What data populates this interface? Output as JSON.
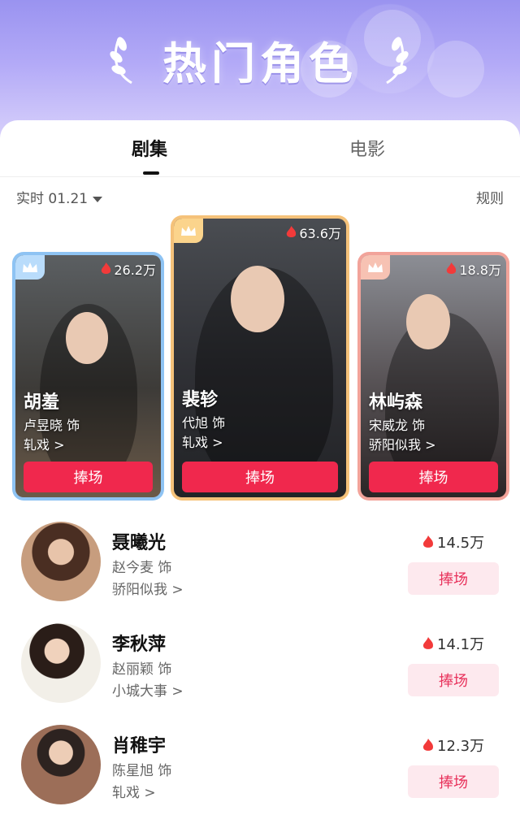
{
  "header": {
    "title": "热门角色"
  },
  "tabs": [
    {
      "label": "剧集",
      "active": true
    },
    {
      "label": "电影",
      "active": false
    }
  ],
  "filter": {
    "realtime": "实时 01.21",
    "rules": "规则"
  },
  "top3": [
    {
      "rank": 2,
      "name": "胡羞",
      "actor": "卢昱晓 饰",
      "drama": "轧戏 >",
      "heat": "26.2万",
      "button": "捧场"
    },
    {
      "rank": 1,
      "name": "裴轸",
      "actor": "代旭 饰",
      "drama": "轧戏 >",
      "heat": "63.6万",
      "button": "捧场"
    },
    {
      "rank": 3,
      "name": "林屿森",
      "actor": "宋威龙 饰",
      "drama": "骄阳似我 >",
      "heat": "18.8万",
      "button": "捧场"
    }
  ],
  "list": [
    {
      "name": "聂曦光",
      "actor": "赵今麦 饰",
      "drama": "骄阳似我 >",
      "heat": "14.5万",
      "button": "捧场"
    },
    {
      "name": "李秋萍",
      "actor": "赵丽颖 饰",
      "drama": "小城大事 >",
      "heat": "14.1万",
      "button": "捧场"
    },
    {
      "name": "肖稚宇",
      "actor": "陈星旭 饰",
      "drama": "轧戏 >",
      "heat": "12.3万",
      "button": "捧场"
    }
  ],
  "colors": {
    "accent": "#f0284d",
    "banner": "#9a93f0",
    "gold": "#f5c27a",
    "silver": "#8ec3f3",
    "bronze": "#f2a39a"
  }
}
